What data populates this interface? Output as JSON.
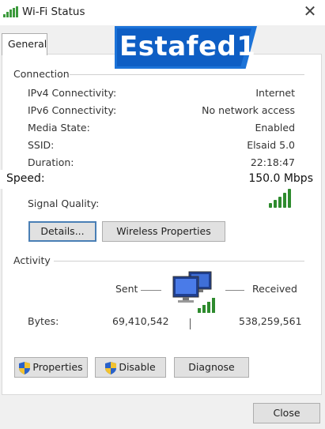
{
  "window": {
    "title": "Wi-Fi Status",
    "close_glyph": "✕"
  },
  "tabs": [
    {
      "label": "General"
    }
  ],
  "watermark": {
    "text": "Estafed1"
  },
  "connection": {
    "group_label": "Connection",
    "rows": [
      {
        "label": "IPv4 Connectivity:",
        "value": "Internet"
      },
      {
        "label": "IPv6 Connectivity:",
        "value": "No network access"
      },
      {
        "label": "Media State:",
        "value": "Enabled"
      },
      {
        "label": "SSID:",
        "value": "Elsaid 5.0"
      },
      {
        "label": "Duration:",
        "value": "22:18:47"
      }
    ],
    "speed": {
      "label": "Speed:",
      "value": "150.0 Mbps"
    },
    "signal_quality": {
      "label": "Signal Quality:",
      "bars_filled": 5,
      "bars_total": 5
    }
  },
  "buttons": {
    "details": "Details...",
    "wireless_properties": "Wireless Properties"
  },
  "activity": {
    "group_label": "Activity",
    "sent_label": "Sent",
    "received_label": "Received",
    "bytes_label": "Bytes:",
    "bytes_sent": "69,410,542",
    "bytes_received": "538,259,561"
  },
  "bottom_buttons": {
    "properties": "Properties",
    "disable": "Disable",
    "diagnose": "Diagnose"
  },
  "footer": {
    "close": "Close"
  },
  "colors": {
    "accent_border": "#4a7fb5",
    "watermark_blue": "#0e5ec4",
    "signal_green": "#2e8b2e"
  },
  "icons": [
    "wifi-signal-icon",
    "close-icon",
    "signal-quality-icon",
    "network-computers-icon",
    "uac-shield-icon"
  ]
}
